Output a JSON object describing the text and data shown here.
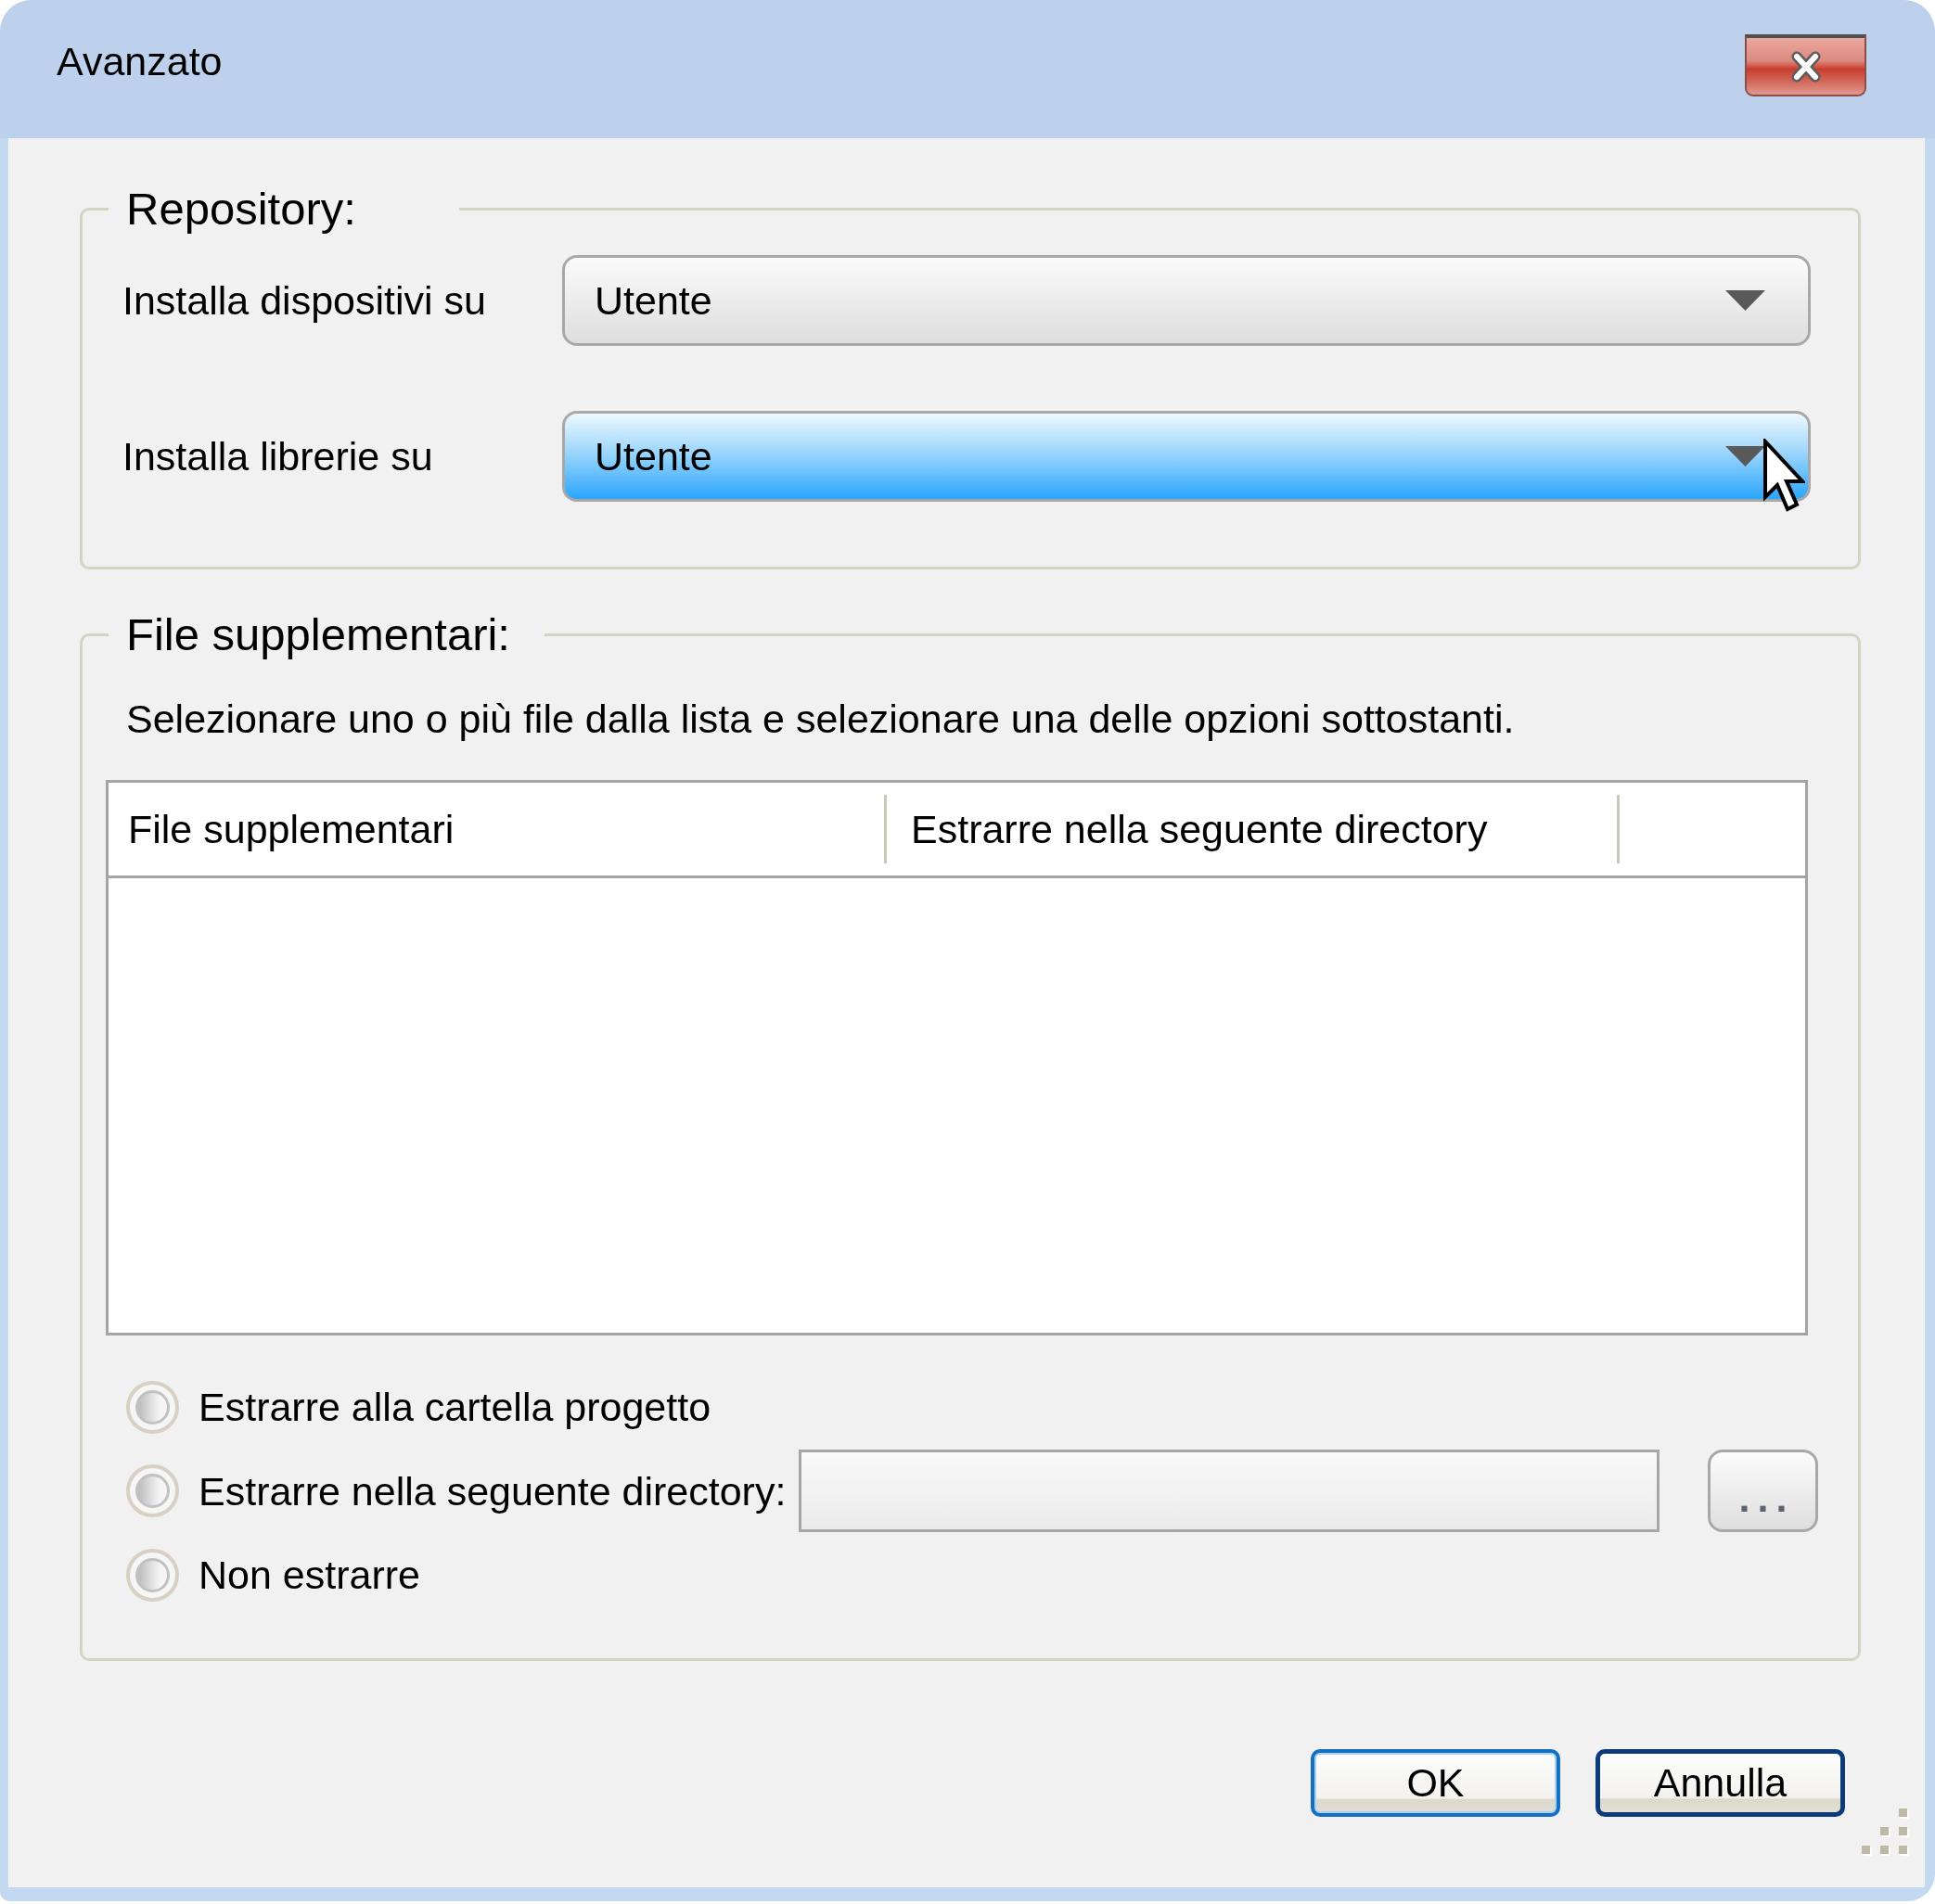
{
  "window": {
    "title": "Avanzato"
  },
  "repository": {
    "legend": "Repository:",
    "rows": [
      {
        "label": "Installa dispositivi su",
        "value": "Utente",
        "hovered": false
      },
      {
        "label": "Installa librerie su",
        "value": "Utente",
        "hovered": true
      }
    ]
  },
  "extra_files": {
    "legend": "File supplementari:",
    "description": "Selezionare uno o più file dalla lista e selezionare una delle opzioni sottostanti.",
    "table": {
      "columns": [
        "File supplementari",
        "Estrarre nella seguente directory"
      ]
    },
    "options": [
      {
        "kind": "plain",
        "label": "Estrarre alla cartella progetto",
        "selected": false
      },
      {
        "kind": "directory",
        "label": "Estrarre nella seguente directory:",
        "selected": false,
        "browse_button": "..."
      },
      {
        "kind": "plain",
        "label": "Non estrarre",
        "selected": false
      }
    ]
  },
  "buttons": [
    {
      "label": "OK",
      "focused": false
    },
    {
      "label": "Annulla",
      "focused": true
    }
  ]
}
